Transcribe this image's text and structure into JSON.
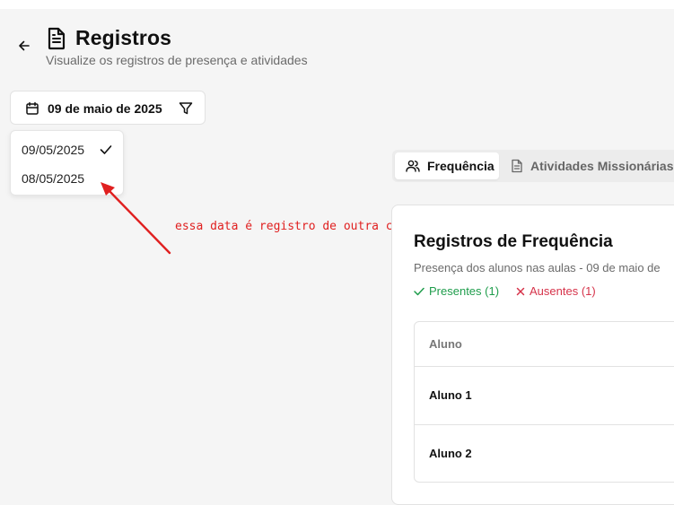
{
  "header": {
    "title": "Registros",
    "subtitle": "Visualize os registros de presença e atividades"
  },
  "date_filter": {
    "selected_label": "09 de maio de 2025",
    "options": [
      {
        "label": "09/05/2025",
        "selected": true
      },
      {
        "label": "08/05/2025",
        "selected": false
      }
    ]
  },
  "annotation": {
    "text": "essa data é registro de outra classe!",
    "color": "#e02020"
  },
  "tabs": [
    {
      "label": "Frequência",
      "icon": "users-icon",
      "active": true
    },
    {
      "label": "Atividades Missionárias",
      "icon": "file-text-icon",
      "active": false
    }
  ],
  "attendance_card": {
    "title": "Registros de Frequência",
    "description": "Presença dos alunos nas aulas - 09 de maio de",
    "present_label": "Presentes (1)",
    "absent_label": "Ausentes (1)",
    "present_color": "#1f9d4c",
    "absent_color": "#d6334a",
    "table": {
      "header": "Aluno",
      "rows": [
        "Aluno 1",
        "Aluno 2"
      ]
    }
  }
}
